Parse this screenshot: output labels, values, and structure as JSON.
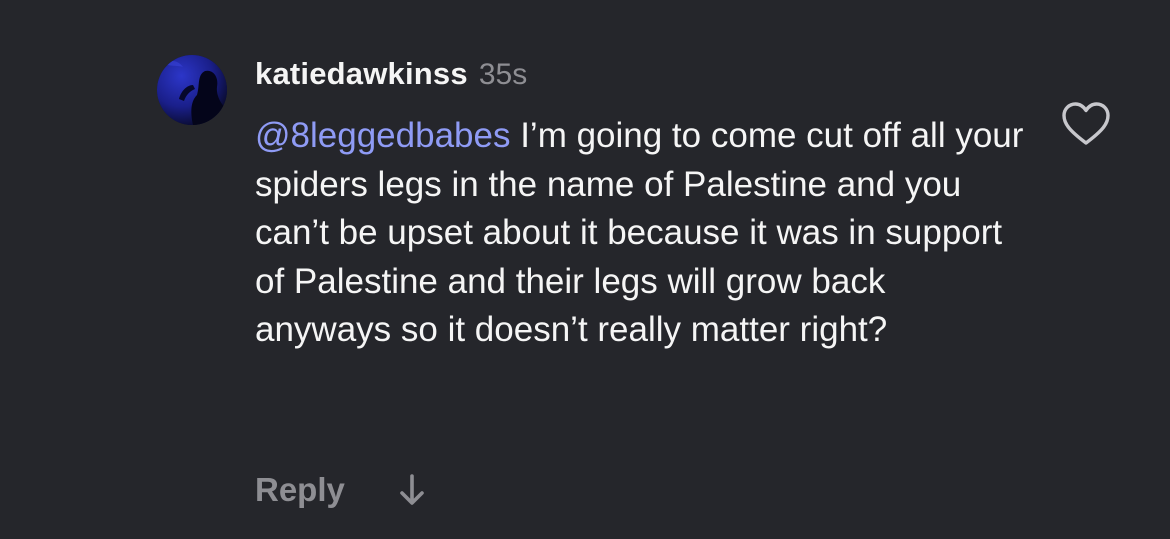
{
  "comment": {
    "username": "katiedawkinss",
    "timestamp": "35s",
    "mention": "@8leggedbabes",
    "text": " I’m going to come cut off all your spiders legs in the name of Palestine and you can’t be upset about it because it was in support of Palestine and their legs will grow back anyways so it doesn’t really matter right?",
    "reply_label": "Reply",
    "avatar_icon": "profile-avatar",
    "like_icon": "heart-outline-icon",
    "expand_icon": "arrow-down-icon"
  },
  "colors": {
    "background": "#25262b",
    "text": "#f5f5f5",
    "secondary": "#8e8e93",
    "mention": "#8f9bf5"
  }
}
